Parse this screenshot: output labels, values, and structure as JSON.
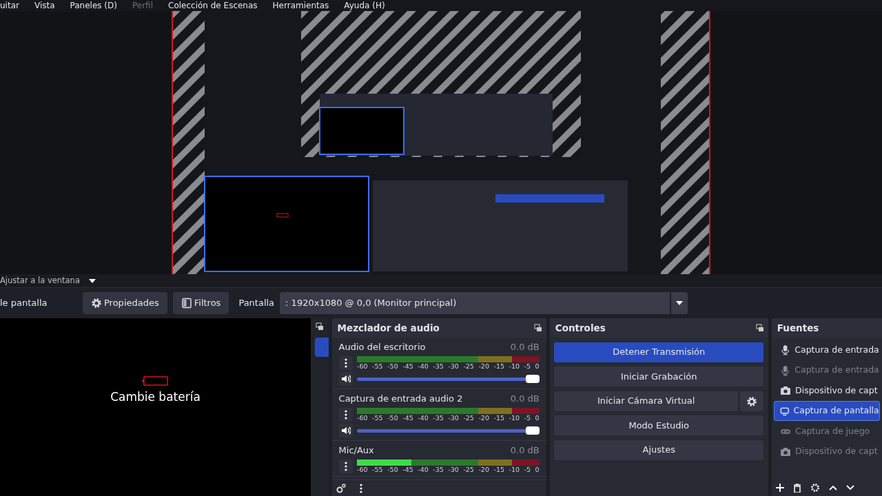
{
  "menu_bar": [
    {
      "label": "uitar",
      "disabled": false
    },
    {
      "label": "Vista",
      "disabled": false
    },
    {
      "label": "Paneles (D)",
      "disabled": false
    },
    {
      "label": "Perfil",
      "disabled": true
    },
    {
      "label": "Colección de Escenas",
      "disabled": false
    },
    {
      "label": "Herramientas",
      "disabled": false
    },
    {
      "label": "Ayuda (H)",
      "disabled": false
    }
  ],
  "zoom_mode": {
    "value": "Ajustar a la ventana"
  },
  "source_toolbar": {
    "source_name": "le pantalla",
    "buttons": [
      {
        "label": "Propiedades"
      },
      {
        "label": "Filtros"
      }
    ],
    "display_label": "Pantalla",
    "display_value": ": 1920x1080 @ 0,0 (Monitor principal)"
  },
  "scene_preview": {
    "text": "Cambie batería"
  },
  "audio_mixer": {
    "title": "Mezclador de audio",
    "channels": [
      {
        "name": "Audio del escritorio",
        "reading": "0.0 dB",
        "scale": [
          "-60",
          "-55",
          "-50",
          "-45",
          "-40",
          "-35",
          "-30",
          "-25",
          "-20",
          "-15",
          "-10",
          "-5",
          "0"
        ],
        "volume": {
          "level": 1
        }
      },
      {
        "name": "Captura de entrada audio 2",
        "reading": "0.0 dB",
        "scale": [
          "-60",
          "-55",
          "-50",
          "-45",
          "-40",
          "-35",
          "-30",
          "-25",
          "-20",
          "-15",
          "-10",
          "-5",
          "0"
        ],
        "volume": {
          "level": 1
        }
      },
      {
        "name": "Mic/Aux",
        "reading": "0.0 dB",
        "meter": {
          "level": 0.3
        },
        "scale": [
          "-60",
          "-55",
          "-50",
          "-45",
          "-40",
          "-35",
          "-30",
          "-25",
          "-20",
          "-15",
          "-10",
          "-5",
          "0"
        ]
      }
    ]
  },
  "controls": {
    "title": "Controles",
    "buttons": [
      {
        "label": "Detener Transmisión",
        "active": true,
        "has_settings": false
      },
      {
        "label": "Iniciar Grabación",
        "active": false,
        "has_settings": false
      },
      {
        "label": "Iniciar Cámara Virtual",
        "active": false,
        "has_settings": true
      },
      {
        "label": "Modo Estudio",
        "active": false,
        "has_settings": false
      },
      {
        "label": "Ajustes",
        "active": false,
        "has_settings": false
      }
    ]
  },
  "sources": {
    "title": "Fuentes",
    "items": [
      {
        "label": "Captura de entrada",
        "kind": "microphone",
        "disabled": false,
        "selected": false
      },
      {
        "label": "Captura de entrada",
        "kind": "microphone",
        "disabled": true,
        "selected": false
      },
      {
        "label": "Dispositivo de capt",
        "kind": "camera",
        "disabled": false,
        "selected": false
      },
      {
        "label": "Captura de pantalla",
        "kind": "monitor",
        "disabled": false,
        "selected": true
      },
      {
        "label": "Captura de juego",
        "kind": "gamepad",
        "disabled": true,
        "selected": false
      },
      {
        "label": "Dispositivo de capt",
        "kind": "camera",
        "disabled": true,
        "selected": false
      }
    ]
  }
}
